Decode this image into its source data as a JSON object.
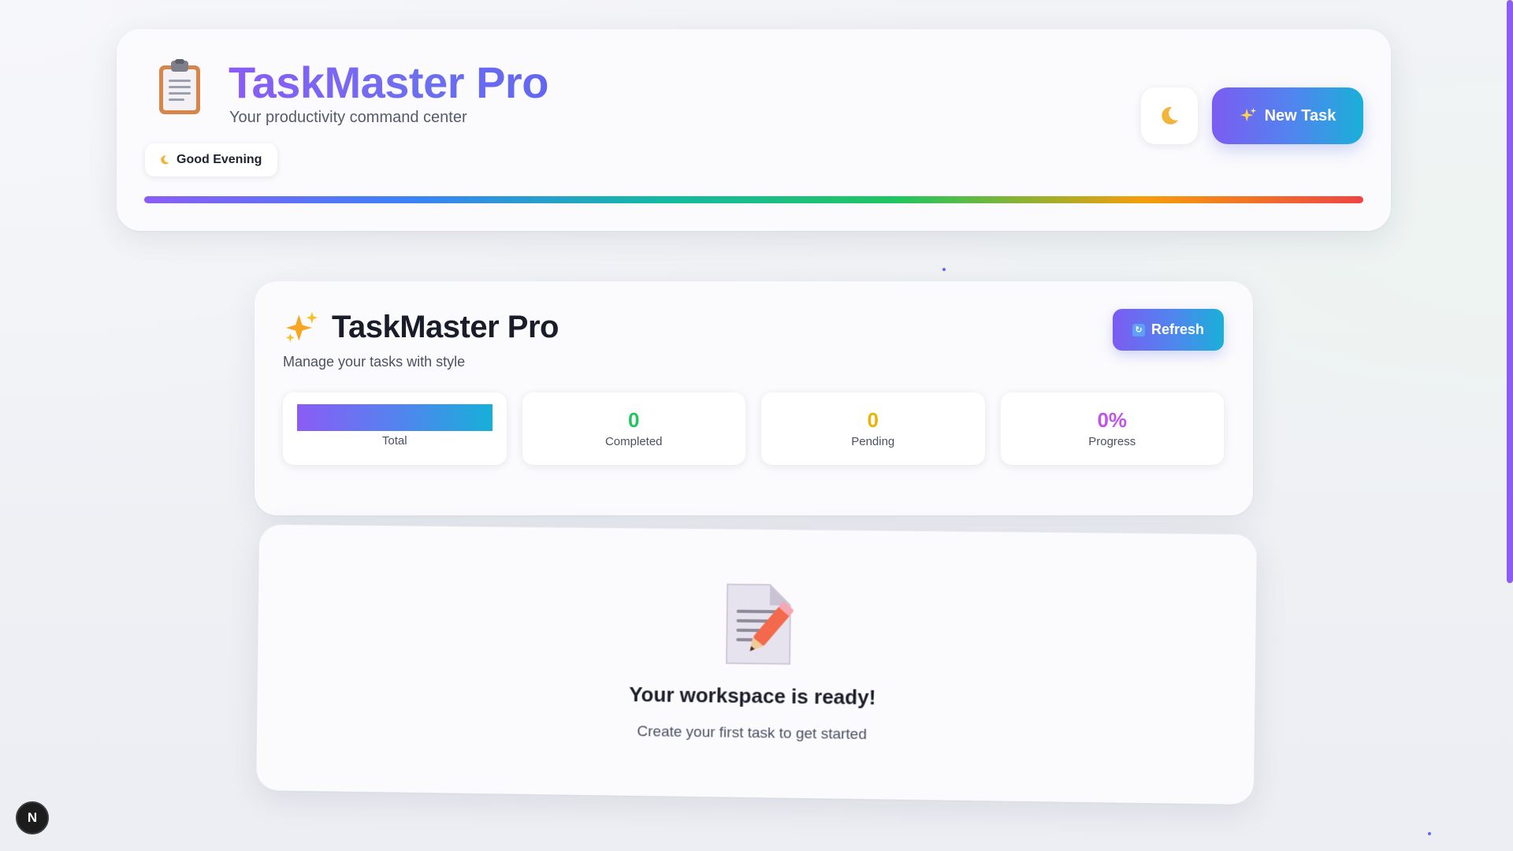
{
  "header": {
    "title": "TaskMaster Pro",
    "subtitle": "Your productivity command center",
    "greeting": "Good Evening",
    "logo_icon": "clipboard-icon",
    "theme_toggle_icon": "moon-icon",
    "new_task_label": "New Task",
    "new_task_icon": "sparkles-icon"
  },
  "main": {
    "title": "TaskMaster Pro",
    "title_icon": "sparkles-icon",
    "subtitle": "Manage your tasks with style",
    "refresh_label": "Refresh",
    "refresh_icon": "refresh-icon",
    "stats": [
      {
        "label": "Total",
        "value": "",
        "color": "#8b5cf6"
      },
      {
        "label": "Completed",
        "value": "0",
        "color": "#22c55e"
      },
      {
        "label": "Pending",
        "value": "0",
        "color": "#eab308"
      },
      {
        "label": "Progress",
        "value": "0%",
        "color": "#c056e8"
      }
    ]
  },
  "empty_state": {
    "icon": "memo-icon",
    "title": "Your workspace is ready!",
    "text": "Create your first task to get started"
  },
  "dev_badge": {
    "label": "N"
  },
  "colors": {
    "accent_purple": "#8b5cf6",
    "accent_blue": "#4f86ee",
    "accent_cyan": "#19b0d8"
  }
}
